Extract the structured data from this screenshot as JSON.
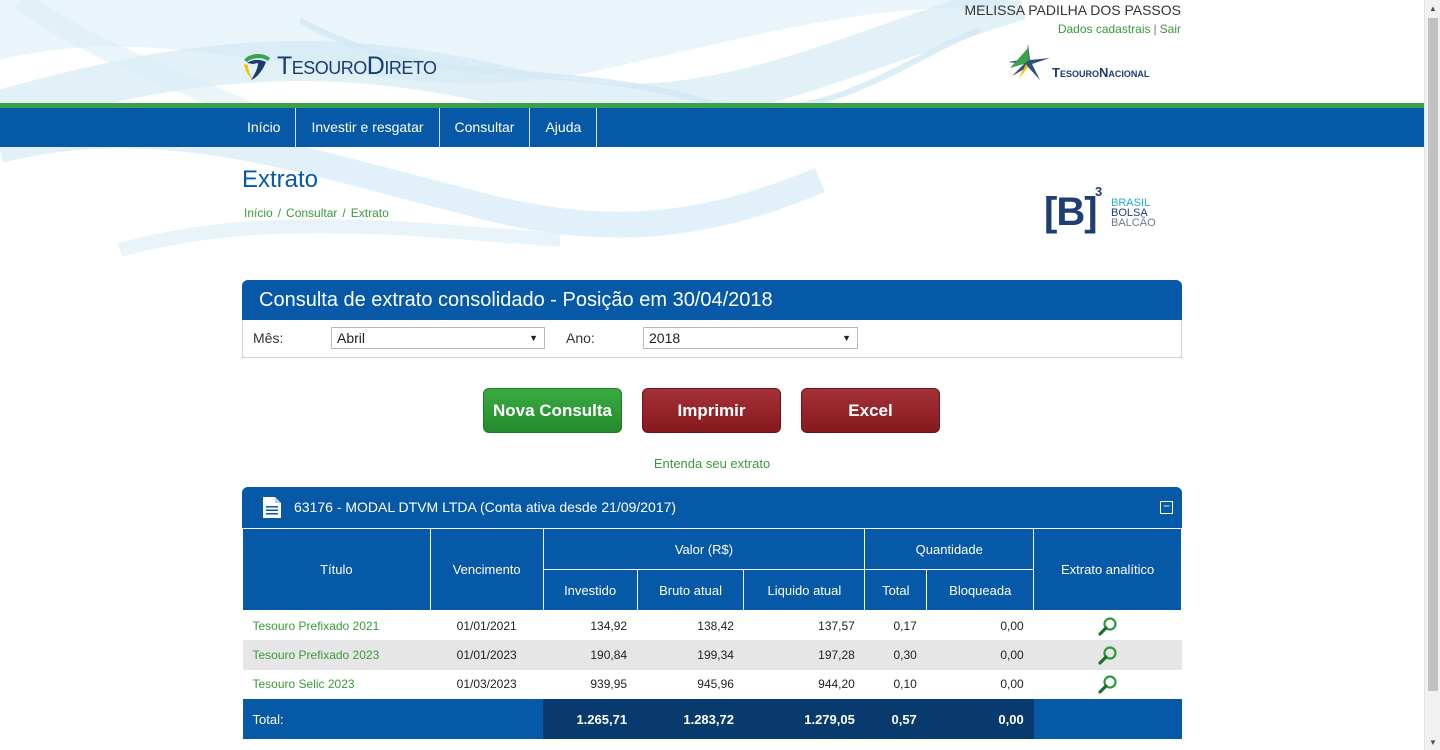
{
  "user": {
    "name": "MELISSA PADILHA DOS PASSOS",
    "dados_label": "Dados cadastrais",
    "sep": "|",
    "sair_label": "Sair"
  },
  "brand": {
    "tesouro_direto": "TesouroDireto",
    "tesouro_nacional": "TesouroNacional",
    "b3_letter": "[B]",
    "b3_sup": "3",
    "b3_words": [
      "BRASIL",
      "BOLSA",
      "BALCÃO"
    ]
  },
  "nav": {
    "items": [
      "Início",
      "Investir e resgatar",
      "Consultar",
      "Ajuda"
    ]
  },
  "page": {
    "title": "Extrato",
    "breadcrumb": [
      "Início",
      "Consultar",
      "Extrato"
    ],
    "breadcrumb_sep": "/"
  },
  "consulta": {
    "title": "Consulta de extrato consolidado - Posição em 30/04/2018",
    "mes_label": "Mês:",
    "mes_value": "Abril",
    "ano_label": "Ano:",
    "ano_value": "2018"
  },
  "buttons": {
    "nova": "Nova Consulta",
    "imprimir": "Imprimir",
    "excel": "Excel"
  },
  "help_link": "Entenda seu extrato",
  "account": {
    "title": "63176 - MODAL DTVM LTDA (Conta ativa desde 21/09/2017)",
    "collapse": "−"
  },
  "table": {
    "headers": {
      "titulo": "Título",
      "vencimento": "Vencimento",
      "valor": "Valor (R$)",
      "quantidade": "Quantidade",
      "extrato": "Extrato analítico",
      "investido": "Investido",
      "bruto": "Bruto atual",
      "liquido": "Liquido atual",
      "total": "Total",
      "bloqueada": "Bloqueada"
    },
    "rows": [
      {
        "titulo": "Tesouro Prefixado 2021",
        "vencimento": "01/01/2021",
        "investido": "134,92",
        "bruto": "138,42",
        "liquido": "137,57",
        "total": "0,17",
        "bloqueada": "0,00"
      },
      {
        "titulo": "Tesouro Prefixado 2023",
        "vencimento": "01/01/2023",
        "investido": "190,84",
        "bruto": "199,34",
        "liquido": "197,28",
        "total": "0,30",
        "bloqueada": "0,00"
      },
      {
        "titulo": "Tesouro Selic 2023",
        "vencimento": "01/03/2023",
        "investido": "939,95",
        "bruto": "945,96",
        "liquido": "944,20",
        "total": "0,10",
        "bloqueada": "0,00"
      }
    ],
    "totals": {
      "label": "Total:",
      "investido": "1.265,71",
      "bruto": "1.283,72",
      "liquido": "1.279,05",
      "total": "0,57",
      "bloqueada": "0,00"
    }
  },
  "colors": {
    "primary_blue": "#0659a6",
    "dark_blue": "#083a6e",
    "green": "#3a9a3a",
    "button_green": "#2f9a37",
    "button_red": "#951f25"
  }
}
